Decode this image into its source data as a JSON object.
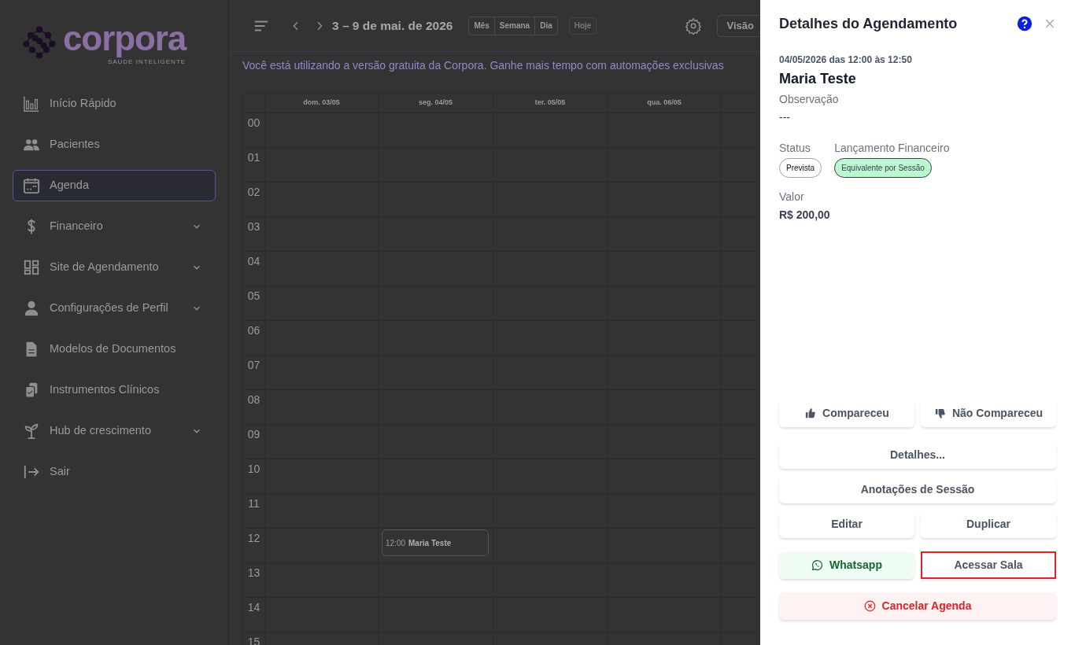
{
  "logo": {
    "name": "corpora",
    "tagline": "SAUDE INTELIGENTE"
  },
  "sidebar": {
    "items": [
      {
        "label": "Início Rápido",
        "selected": false,
        "expandable": false
      },
      {
        "label": "Pacientes",
        "selected": false,
        "expandable": false
      },
      {
        "label": "Agenda",
        "selected": true,
        "expandable": false
      },
      {
        "label": "Financeiro",
        "selected": false,
        "expandable": true
      },
      {
        "label": "Site de Agendamento",
        "selected": false,
        "expandable": true
      },
      {
        "label": "Configurações de Perfil",
        "selected": false,
        "expandable": true
      },
      {
        "label": "Modelos de Documentos",
        "selected": false,
        "expandable": false
      },
      {
        "label": "Instrumentos Clínicos",
        "selected": false,
        "expandable": false
      },
      {
        "label": "Hub de crescimento",
        "selected": false,
        "expandable": true
      },
      {
        "label": "Sair",
        "selected": false,
        "expandable": false
      }
    ]
  },
  "toolbar": {
    "range": "3 – 9 de mai. de 2026",
    "views": [
      {
        "label": "Mês",
        "selected": false
      },
      {
        "label": "Semana",
        "selected": false
      },
      {
        "label": "Dia",
        "selected": false
      }
    ],
    "today": {
      "label": "Hoje",
      "disabled": true
    },
    "view_button": "Visão"
  },
  "banner": "Você está utilizando a versão gratuita da Corpora. Ganhe mais tempo com automações exclusivas",
  "calendar": {
    "days": [
      {
        "label": "dom. 03/05"
      },
      {
        "label": "seg. 04/05",
        "events": [
          {
            "time": "12:00",
            "title": "Maria Teste"
          }
        ]
      },
      {
        "label": "ter. 05/05"
      },
      {
        "label": "qua. 06/05"
      }
    ],
    "hours": [
      "00",
      "01",
      "02",
      "03",
      "04",
      "05",
      "06",
      "07",
      "08",
      "09",
      "10",
      "11",
      "12",
      "13",
      "14",
      "15"
    ]
  },
  "panel": {
    "title": "Detalhes do Agendamento",
    "datetime": "04/05/2026 das 12:00 às 12:50",
    "patient": "Maria Teste",
    "observation_label": "Observação",
    "observation": "---",
    "status_label": "Status",
    "status": "Prevista",
    "finance_label": "Lançamento Financeiro",
    "finance": "Equivalente por Sessão",
    "value_label": "Valor",
    "value": "R$ 200,00",
    "action_rows": [
      [
        {
          "label": "Compareceu",
          "kind": "attended",
          "highlighted": false
        },
        {
          "label": "Não Compareceu",
          "kind": "missed",
          "highlighted": false
        }
      ],
      [
        {
          "label": "Detalhes...",
          "kind": "plain",
          "highlighted": false
        }
      ],
      [
        {
          "label": "Anotações de Sessão",
          "kind": "plain",
          "highlighted": false
        }
      ],
      [
        {
          "label": "Editar",
          "kind": "plain",
          "highlighted": false
        },
        {
          "label": "Duplicar",
          "kind": "plain",
          "highlighted": false
        }
      ],
      [
        {
          "label": "Whatsapp",
          "kind": "whatsapp",
          "highlighted": false
        },
        {
          "label": "Acessar Sala",
          "kind": "plain",
          "highlighted": true
        }
      ],
      [
        {
          "label": "Cancelar Agenda",
          "kind": "cancel",
          "highlighted": false
        }
      ]
    ]
  }
}
